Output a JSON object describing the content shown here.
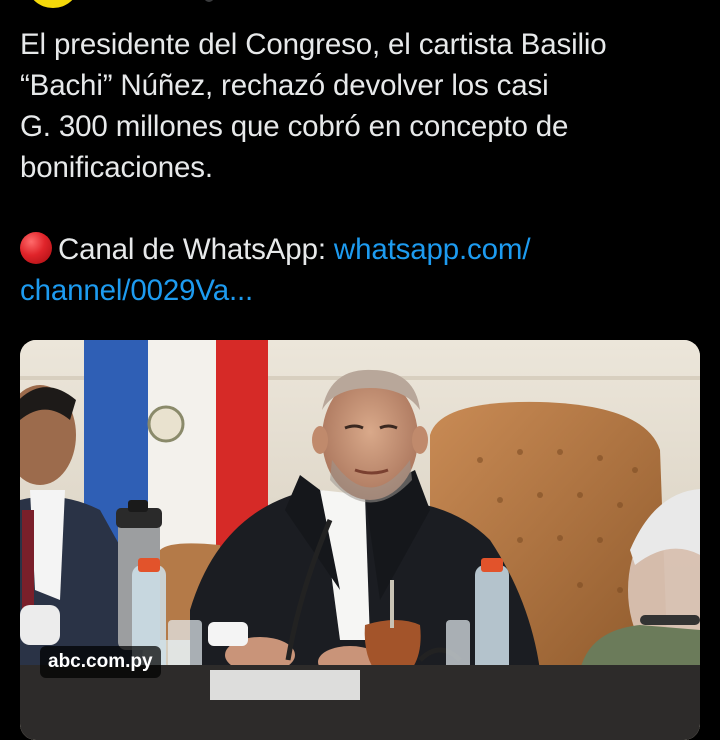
{
  "tweet": {
    "line1": "El presidente del Congreso, el cartista Basilio\n“Bachi” Núñez, rechazó devolver los casi\nG. 300 millones que cobró en concepto de\nbonificaciones.",
    "whatsapp_label": "Canal de WhatsApp: ",
    "whatsapp_link": "whatsapp.com/\nchannel/0029Va...",
    "emoji": "red-circle-icon"
  },
  "media": {
    "source_badge": "abc.com.py"
  },
  "colors": {
    "background": "#000000",
    "text": "#e7e9ea",
    "link": "#1d9bf0"
  }
}
